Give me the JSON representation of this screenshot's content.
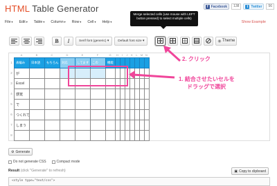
{
  "header": {
    "title_html": "HTML",
    "title_rest": " Table Generator"
  },
  "social": {
    "facebook_label": "Facebook",
    "facebook_count": "138",
    "twitter_label": "Twitter",
    "twitter_count": "56"
  },
  "menu": {
    "items": [
      "File",
      "Edit",
      "Table",
      "Column",
      "Row",
      "Cell",
      "Help"
    ],
    "show_example": "Show Example"
  },
  "tooltip": {
    "text": "Merge selected cells (use mouse with LEFT button pressed) to select multiple cells)"
  },
  "toolbar": {
    "font_family": "Serif font (generic)",
    "font_size": "Default font size",
    "theme_label": "Theme"
  },
  "table": {
    "col_letters": [
      "A",
      "B",
      "C",
      "D",
      "E",
      "F",
      "G",
      "H",
      "I",
      "J",
      "K",
      "L",
      "M",
      "N"
    ],
    "row_numbers": [
      "1",
      "2",
      "3",
      "4",
      "5",
      "6",
      "7",
      "8"
    ],
    "header_row": [
      "表編み",
      "日本語",
      "もちろん",
      "対応",
      "してます",
      "この",
      "機能",
      "",
      "",
      "",
      "",
      "",
      "",
      ""
    ],
    "rows": [
      [
        "が",
        "",
        "",
        "",
        "",
        "",
        "",
        "",
        "",
        "",
        "",
        "",
        "",
        ""
      ],
      [
        "Excel",
        "",
        "",
        "",
        "",
        "",
        "",
        "",
        "",
        "",
        "",
        "",
        "",
        ""
      ],
      [
        "感覚",
        "",
        "",
        "",
        "",
        "",
        "",
        "",
        "",
        "",
        "",
        "",
        "",
        ""
      ],
      [
        "で",
        "",
        "",
        "",
        "",
        "",
        "",
        "",
        "",
        "",
        "",
        "",
        "",
        ""
      ],
      [
        "つくれて",
        "",
        "",
        "",
        "",
        "",
        "",
        "",
        "",
        "",
        "",
        "",
        "",
        ""
      ],
      [
        "しまう",
        "",
        "",
        "",
        "",
        "",
        "",
        "",
        "",
        "",
        "",
        "",
        "",
        ""
      ],
      [
        "",
        "",
        "",
        "",
        "",
        "",
        "",
        "",
        "",
        "",
        "",
        "",
        "",
        ""
      ]
    ]
  },
  "annotations": {
    "step1_line1": "1. 結合させたいセルを",
    "step1_line2": "ドラッグで選択",
    "step2": "2. クリック"
  },
  "actions": {
    "generate_label": "Generate",
    "opt_no_css": "Do not generate CSS",
    "opt_compact": "Compact mode",
    "result_label": "Result",
    "result_hint": "(click \"Generate\" to refresh)",
    "copy_label": "Copy to clipboard",
    "code_preview": "<style type=\"text/css\">"
  },
  "colors": {
    "header_blue": "#1aa0e3",
    "annotation_pink": "#f0459a",
    "title_orange": "#e44d26"
  }
}
